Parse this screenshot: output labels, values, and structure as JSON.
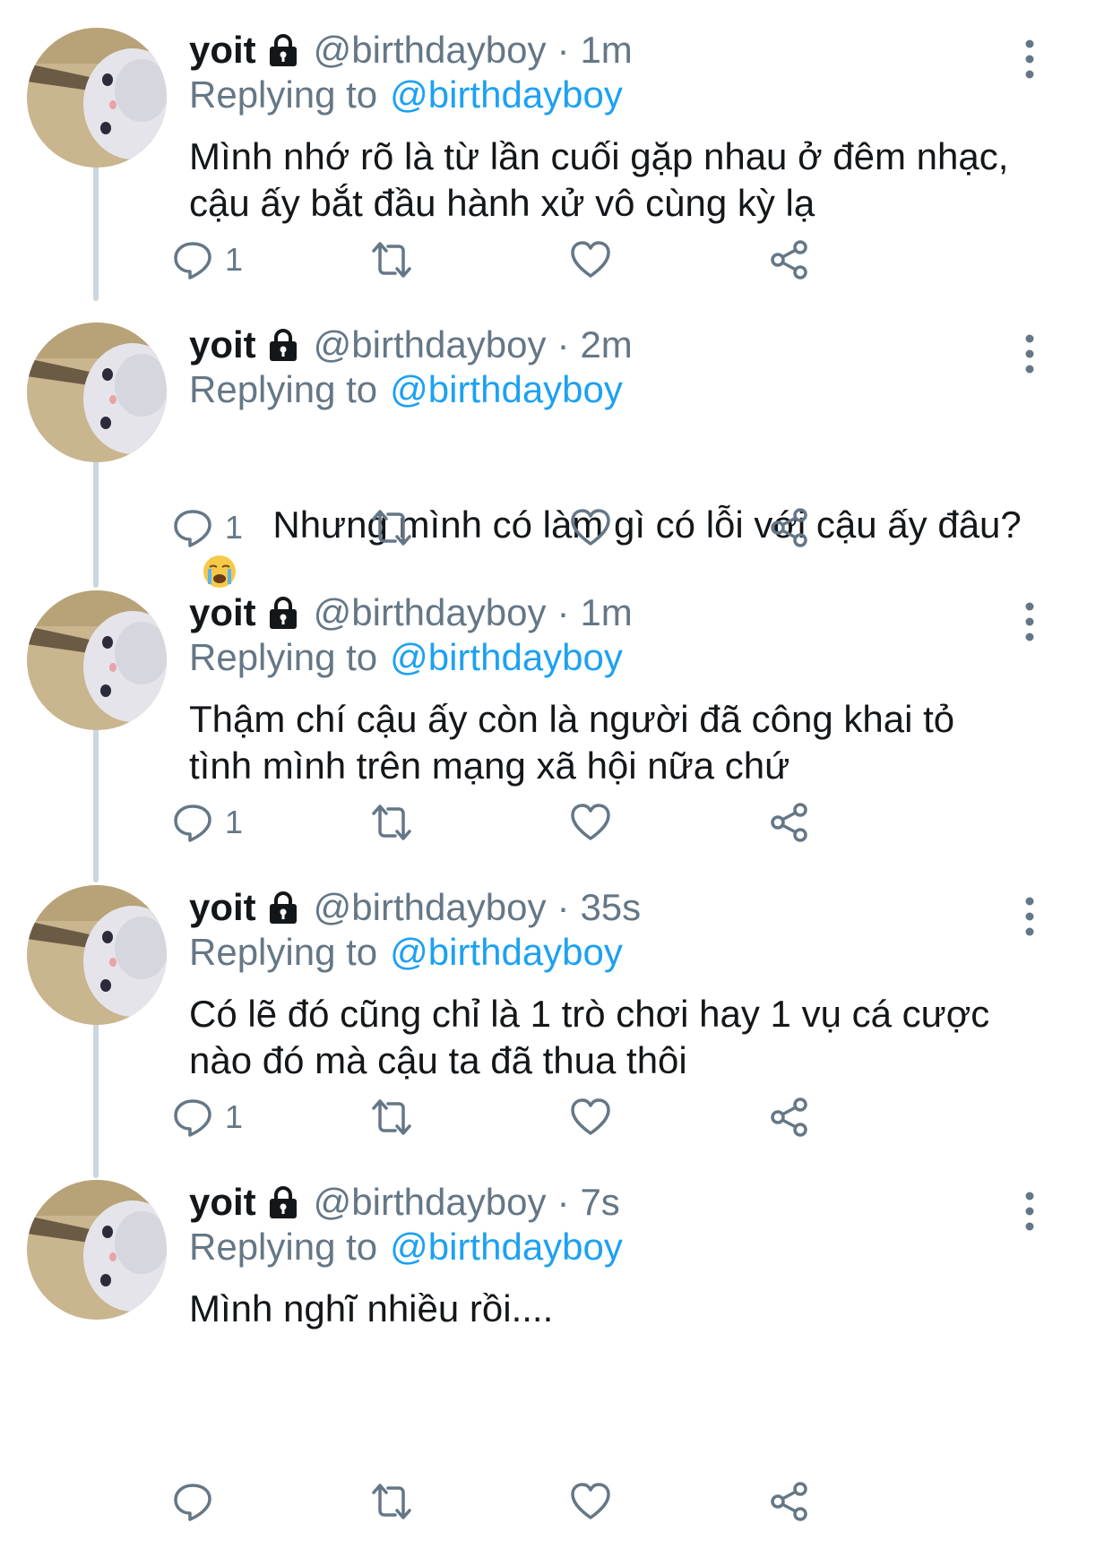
{
  "colors": {
    "accent": "#1da1f2",
    "secondary_text": "#657786",
    "primary_text": "#14171a",
    "thread_line": "#ccd6dd"
  },
  "tweets": [
    {
      "display_name": "yoit",
      "handle": "@birthdayboy",
      "separator": "·",
      "time": "1m",
      "reply_prefix": "Replying to",
      "reply_target": "@birthdayboy",
      "text": "Mình nhớ rõ là từ lần cuối gặp nhau ở đêm nhạc,\ncậu ấy bắt đầu hành xử vô cùng kỳ lạ",
      "reply_count": "1",
      "icons": [
        "lock-icon",
        "more-icon",
        "reply-icon",
        "retweet-icon",
        "like-icon",
        "share-icon"
      ]
    },
    {
      "display_name": "yoit",
      "handle": "@birthdayboy",
      "separator": "·",
      "time": "2m",
      "reply_prefix": "Replying to",
      "reply_target": "@birthdayboy",
      "text": "Nhưng mình có làm gì có lỗi với cậu ấy đâu?",
      "emoji": "crying-face-emoji",
      "reply_count": "1"
    },
    {
      "display_name": "yoit",
      "handle": "@birthdayboy",
      "separator": "·",
      "time": "1m",
      "reply_prefix": "Replying to",
      "reply_target": "@birthdayboy",
      "text": "Thậm chí cậu ấy còn là người đã công khai tỏ\ntình mình trên mạng xã hội nữa chứ",
      "reply_count": "1"
    },
    {
      "display_name": "yoit",
      "handle": "@birthdayboy",
      "separator": "·",
      "time": "35s",
      "reply_prefix": "Replying to",
      "reply_target": "@birthdayboy",
      "text": "Có lẽ đó cũng chỉ là 1 trò chơi hay 1 vụ cá cược\nnào đó mà cậu ta đã thua thôi",
      "reply_count": "1"
    },
    {
      "display_name": "yoit",
      "handle": "@birthdayboy",
      "separator": "·",
      "time": "7s",
      "reply_prefix": "Replying to",
      "reply_target": "@birthdayboy",
      "text": "Mình nghĩ nhiều rồi....",
      "reply_count": ""
    }
  ]
}
